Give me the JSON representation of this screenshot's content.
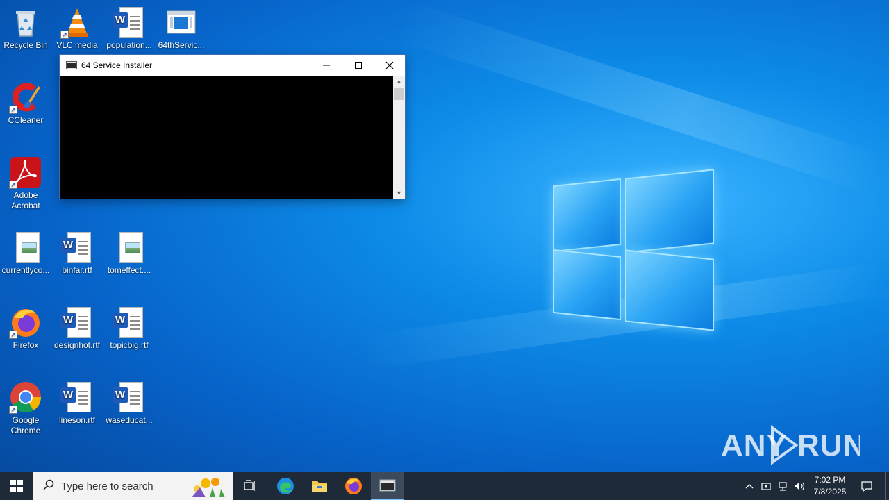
{
  "desktop": {
    "icons": [
      {
        "label": "Recycle Bin",
        "icon": "recycle-bin-icon"
      },
      {
        "label": "VLC media",
        "icon": "vlc-icon"
      },
      {
        "label": "population...",
        "icon": "word-doc-icon"
      },
      {
        "label": "64thServic...",
        "icon": "app-window-icon"
      },
      {
        "label": "CCleaner",
        "icon": "ccleaner-icon"
      },
      {
        "label": "Adobe\nAcrobat",
        "icon": "acrobat-icon"
      },
      {
        "label": "currentlyco...",
        "icon": "image-file-icon"
      },
      {
        "label": "binfar.rtf",
        "icon": "word-doc-icon"
      },
      {
        "label": "tomeffect....",
        "icon": "image-file-icon"
      },
      {
        "label": "Firefox",
        "icon": "firefox-icon"
      },
      {
        "label": "designhot.rtf",
        "icon": "word-doc-icon"
      },
      {
        "label": "topicbig.rtf",
        "icon": "word-doc-icon"
      },
      {
        "label": "Google\nChrome",
        "icon": "chrome-icon"
      },
      {
        "label": "lineson.rtf",
        "icon": "word-doc-icon"
      },
      {
        "label": "waseducat...",
        "icon": "word-doc-icon"
      }
    ]
  },
  "window": {
    "title": "64 Service Installer",
    "minimize_label": "—",
    "maximize_label": "☐",
    "close_label": "✕"
  },
  "taskbar": {
    "search_placeholder": "Type here to search",
    "clock_time": "7:02 PM",
    "clock_date": "7/8/2025"
  },
  "watermark": {
    "text": "ANY RUN"
  },
  "colors": {
    "taskbar": "#1e2a38",
    "desktop_accent": "#0d8be8"
  }
}
